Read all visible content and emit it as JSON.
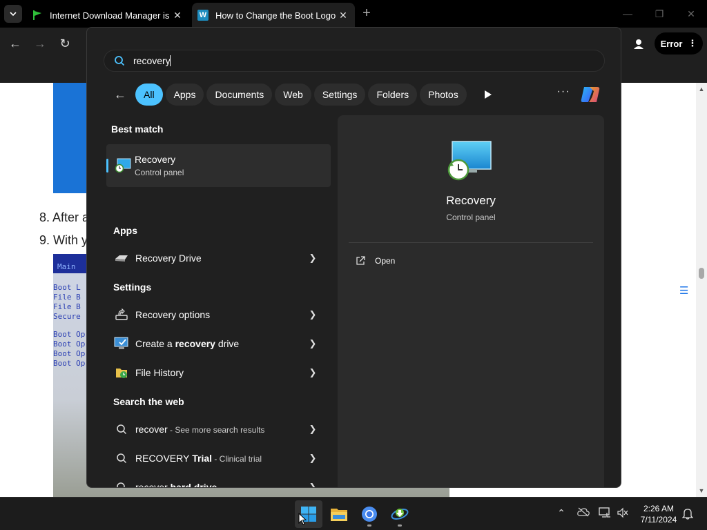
{
  "browser": {
    "tabs": [
      {
        "title": "Internet Download Manager is",
        "close": "✕"
      },
      {
        "title": "How to Change the Boot Logo",
        "close": "✕",
        "favicon_letter": "W"
      }
    ],
    "new_tab": "+",
    "error_label": "Error"
  },
  "page": {
    "step8": "8. After a",
    "step9": "9. With y",
    "bios_header": "Main",
    "bios_lines": [
      "Boot L",
      "File B",
      "File B",
      "Secure",
      "Boot Op",
      "Boot Op",
      "Boot Op",
      "Boot Op"
    ]
  },
  "search": {
    "query": "recovery",
    "filters": [
      "All",
      "Apps",
      "Documents",
      "Web",
      "Settings",
      "Folders",
      "Photos"
    ],
    "selected_filter": "All",
    "more": "···",
    "best_match_heading": "Best match",
    "best_match": {
      "title": "Recovery",
      "subtitle": "Control panel"
    },
    "apps_heading": "Apps",
    "apps": [
      {
        "label": "Recovery Drive"
      }
    ],
    "settings_heading": "Settings",
    "settings": [
      {
        "label": "Recovery options"
      },
      {
        "prefix": "Create a ",
        "bold": "recovery",
        "suffix": " drive"
      },
      {
        "label": "File History"
      }
    ],
    "web_heading": "Search the web",
    "web": [
      {
        "main": "recover",
        "sub": " - See more search results"
      },
      {
        "main": "RECOVERY",
        "bold": " Trial",
        "sub": " - Clinical trial"
      },
      {
        "main": "recover",
        "bold": " hard drive"
      }
    ],
    "preview": {
      "title": "Recovery",
      "subtitle": "Control panel",
      "action": "Open"
    }
  },
  "taskbar": {
    "time": "2:26 AM",
    "date": "7/11/2024"
  },
  "colors": {
    "accent": "#4cc2ff",
    "panel_bg": "#202020",
    "preview_bg": "#2b2b2b",
    "chip_bg": "#2d2d2d"
  }
}
